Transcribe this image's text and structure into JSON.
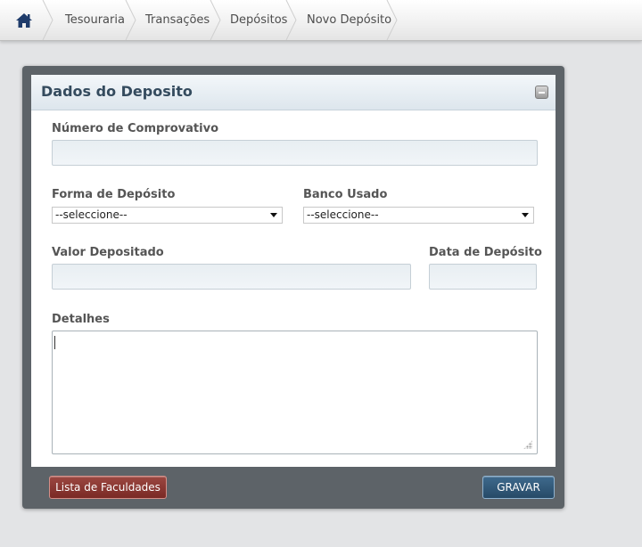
{
  "breadcrumb": {
    "home_icon": "home-icon",
    "items": [
      {
        "label": "Tesouraria"
      },
      {
        "label": "Transações"
      },
      {
        "label": "Depósitos"
      },
      {
        "label": "Novo Depósito"
      }
    ]
  },
  "panel": {
    "title": "Dados do Deposito",
    "collapse_icon": "minimize-icon"
  },
  "form": {
    "comprovativo": {
      "label": "Número de Comprovativo",
      "value": ""
    },
    "forma": {
      "label": "Forma de Depósito",
      "selected": "--seleccione--"
    },
    "banco": {
      "label": "Banco Usado",
      "selected": "--seleccione--"
    },
    "valor": {
      "label": "Valor Depositado",
      "value": ""
    },
    "data": {
      "label": "Data de Depósito",
      "value": ""
    },
    "detalhes": {
      "label": "Detalhes",
      "value": ""
    }
  },
  "footer": {
    "list_button": "Lista de Faculdades",
    "save_button": "GRAVAR"
  },
  "colors": {
    "accent_blue": "#2f5778",
    "accent_red": "#8a3731",
    "title_text": "#344b5e"
  }
}
